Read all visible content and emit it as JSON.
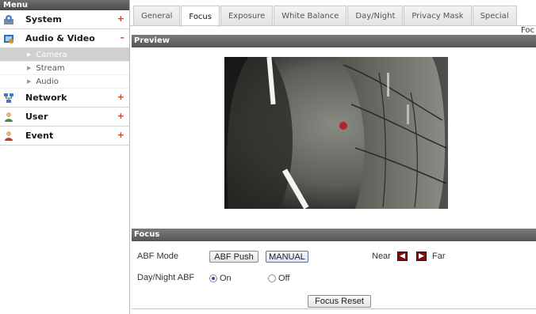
{
  "sidebar": {
    "header": "Menu",
    "items": [
      {
        "label": "System",
        "sign": "+",
        "icon": "system-icon"
      },
      {
        "label": "Audio & Video",
        "sign": "–",
        "icon": "audio-video-icon",
        "children": [
          {
            "label": "Camera",
            "active": true
          },
          {
            "label": "Stream",
            "active": false
          },
          {
            "label": "Audio",
            "active": false
          }
        ]
      },
      {
        "label": "Network",
        "sign": "+",
        "icon": "network-icon"
      },
      {
        "label": "User",
        "sign": "+",
        "icon": "user-icon"
      },
      {
        "label": "Event",
        "sign": "+",
        "icon": "event-icon"
      }
    ]
  },
  "tabs": {
    "items": [
      "General",
      "Focus",
      "Exposure",
      "White Balance",
      "Day/Night",
      "Privacy Mask",
      "Special"
    ],
    "active": "Focus",
    "trailing": "Foc"
  },
  "preview": {
    "title": "Preview"
  },
  "focus": {
    "title": "Focus",
    "abf_mode_label": "ABF Mode",
    "abf_push_button": "ABF Push",
    "manual_button": "MANUAL",
    "near_label": "Near",
    "far_label": "Far",
    "day_night_abf_label": "Day/Night ABF",
    "on_label": "On",
    "off_label": "Off",
    "day_night_abf_selected": "On",
    "reset_button": "Focus Reset"
  },
  "colors": {
    "accent_sign": "#d23c1a",
    "section_bar": "#666666",
    "focus_arrow": "#7a1010"
  }
}
